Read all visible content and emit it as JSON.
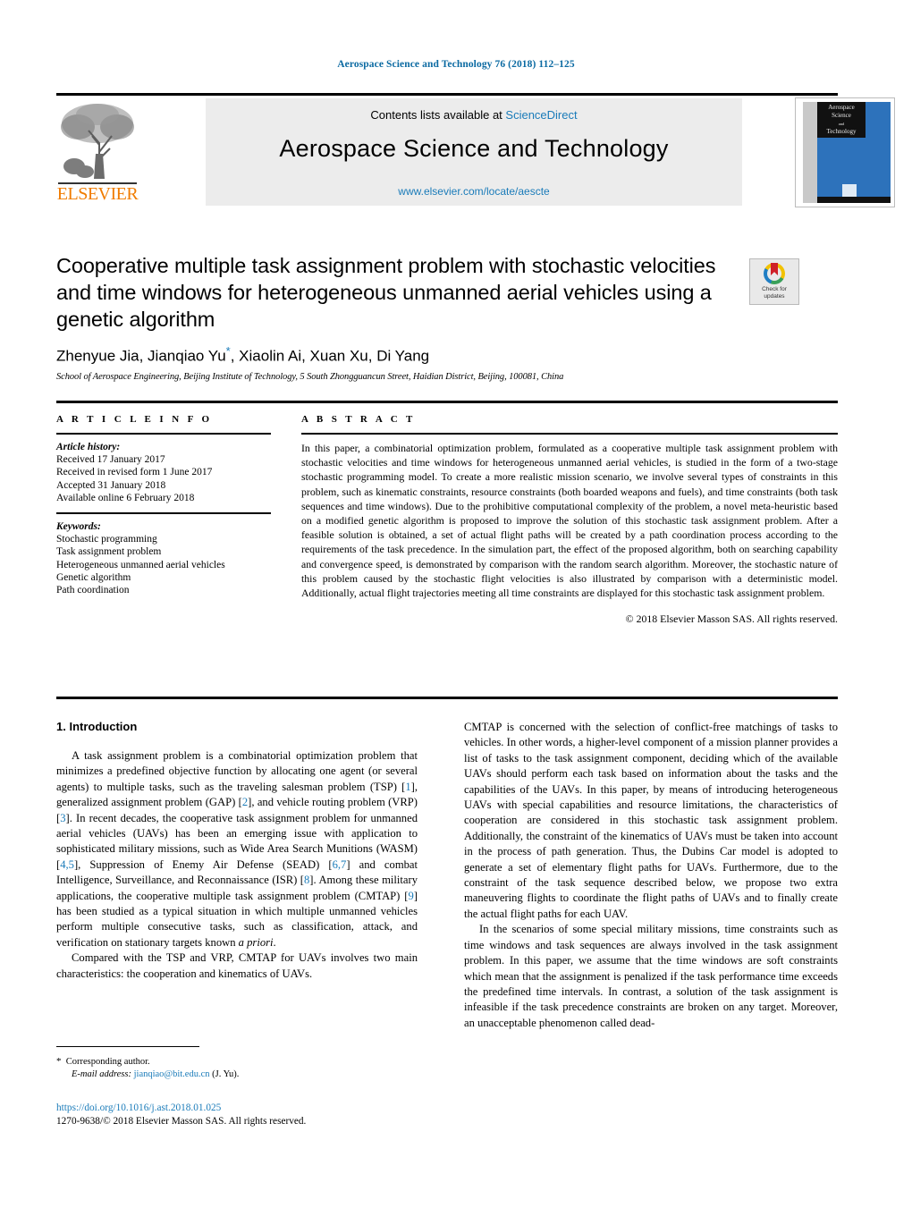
{
  "running_head": "Aerospace Science and Technology 76 (2018) 112–125",
  "masthead": {
    "contents_prefix": "Contents lists available at ",
    "sciencedirect": "ScienceDirect",
    "journal_title": "Aerospace Science and Technology",
    "journal_url": "www.elsevier.com/locate/aescte",
    "publisher_logo_text": "ELSEVIER",
    "cover_line1": "Aerospace",
    "cover_line2": "Science",
    "cover_line3": "and",
    "cover_line4": "Technology"
  },
  "article": {
    "title": "Cooperative multiple task assignment problem with stochastic velocities and time windows for heterogeneous unmanned aerial vehicles using a genetic algorithm",
    "authors": "Zhenyue Jia, Jianqiao Yu",
    "authors_tail": ", Xiaolin Ai, Xuan Xu, Di Yang",
    "corresponding_marker": "*",
    "affiliation": "School of Aerospace Engineering, Beijing Institute of Technology, 5 South Zhongguancun Street, Haidian District, Beijing, 100081, China"
  },
  "crossmark": {
    "line1": "Check for",
    "line2": "updates"
  },
  "info": {
    "label": "A R T I C L E   I N F O",
    "history_head": "Article history:",
    "history": [
      "Received 17 January 2017",
      "Received in revised form 1 June 2017",
      "Accepted 31 January 2018",
      "Available online 6 February 2018"
    ],
    "keywords_head": "Keywords:",
    "keywords": [
      "Stochastic programming",
      "Task assignment problem",
      "Heterogeneous unmanned aerial vehicles",
      "Genetic algorithm",
      "Path coordination"
    ]
  },
  "abstract": {
    "label": "A B S T R A C T",
    "text": "In this paper, a combinatorial optimization problem, formulated as a cooperative multiple task assignment problem with stochastic velocities and time windows for heterogeneous unmanned aerial vehicles, is studied in the form of a two-stage stochastic programming model. To create a more realistic mission scenario, we involve several types of constraints in this problem, such as kinematic constraints, resource constraints (both boarded weapons and fuels), and time constraints (both task sequences and time windows). Due to the prohibitive computational complexity of the problem, a novel meta-heuristic based on a modified genetic algorithm is proposed to improve the solution of this stochastic task assignment problem. After a feasible solution is obtained, a set of actual flight paths will be created by a path coordination process according to the requirements of the task precedence. In the simulation part, the effect of the proposed algorithm, both on searching capability and convergence speed, is demonstrated by comparison with the random search algorithm. Moreover, the stochastic nature of this problem caused by the stochastic flight velocities is also illustrated by comparison with a deterministic model. Additionally, actual flight trajectories meeting all time constraints are displayed for this stochastic task assignment problem.",
    "copyright": "© 2018 Elsevier Masson SAS. All rights reserved."
  },
  "body": {
    "section_heading": "1. Introduction",
    "left_p1_a": "A task assignment problem is a combinatorial optimization problem that minimizes a predefined objective function by allocating one agent (or several agents) to multiple tasks, such as the traveling salesman problem (TSP) [",
    "left_p1_ref1": "1",
    "left_p1_b": "], generalized assignment problem (GAP) [",
    "left_p1_ref2": "2",
    "left_p1_c": "], and vehicle routing problem (VRP) [",
    "left_p1_ref3": "3",
    "left_p1_d": "]. In recent decades, the cooperative task assignment problem for unmanned aerial vehicles (UAVs) has been an emerging issue with application to sophisticated military missions, such as Wide Area Search Munitions (WASM) [",
    "left_p1_ref4": "4,5",
    "left_p1_e": "], Suppression of Enemy Air Defense (SEAD) [",
    "left_p1_ref5": "6,7",
    "left_p1_f": "] and combat Intelligence, Surveillance, and Reconnaissance (ISR) [",
    "left_p1_ref6": "8",
    "left_p1_g": "]. Among these military applications, the cooperative multiple task assignment problem (CMTAP) [",
    "left_p1_ref7": "9",
    "left_p1_h": "] has been studied as a typical situation in which multiple unmanned vehicles perform multiple consecutive tasks, such as classification, attack, and verification on stationary targets known ",
    "left_p1_italic": "a priori",
    "left_p1_i": ".",
    "left_p2": "Compared with the TSP and VRP, CMTAP for UAVs involves two main characteristics: the cooperation and kinematics of UAVs.",
    "right_p1": "CMTAP is concerned with the selection of conflict-free matchings of tasks to vehicles. In other words, a higher-level component of a mission planner provides a list of tasks to the task assignment component, deciding which of the available UAVs should perform each task based on information about the tasks and the capabilities of the UAVs. In this paper, by means of introducing heterogeneous UAVs with special capabilities and resource limitations, the characteristics of cooperation are considered in this stochastic task assignment problem. Additionally, the constraint of the kinematics of UAVs must be taken into account in the process of path generation. Thus, the Dubins Car model is adopted to generate a set of elementary flight paths for UAVs. Furthermore, due to the constraint of the task sequence described below, we propose two extra maneuvering flights to coordinate the flight paths of UAVs and to finally create the actual flight paths for each UAV.",
    "right_p2": "In the scenarios of some special military missions, time constraints such as time windows and task sequences are always involved in the task assignment problem. In this paper, we assume that the time windows are soft constraints which mean that the assignment is penalized if the task performance time exceeds the predefined time intervals. In contrast, a solution of the task assignment is infeasible if the task precedence constraints are broken on any target. Moreover, an unacceptable phenomenon called dead-"
  },
  "footer": {
    "corresponding_marker": "*",
    "corresponding_label": "Corresponding author.",
    "email_label": "E-mail address:",
    "email": "jianqiao@bit.edu.cn",
    "email_owner": "(J. Yu).",
    "doi": "https://doi.org/10.1016/j.ast.2018.01.025",
    "issn_line": "1270-9638/© 2018 Elsevier Masson SAS. All rights reserved."
  },
  "colors": {
    "link": "#1a7bb9",
    "running_head": "#0b6aa2",
    "elsevier_orange": "#F07C00",
    "cover_blue": "#2d72bb"
  }
}
